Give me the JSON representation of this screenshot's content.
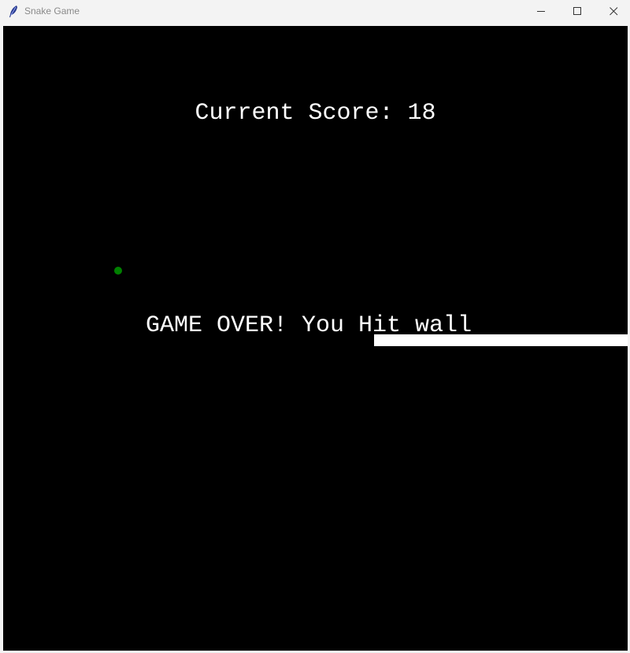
{
  "window": {
    "title": "Snake Game",
    "icon": "feather-icon"
  },
  "controls": {
    "minimize": "minimize-icon",
    "maximize": "maximize-icon",
    "close": "close-icon"
  },
  "game": {
    "score_text": "Current Score: 18",
    "score": 18,
    "game_over_text": "GAME OVER! You Hit wall",
    "background_color": "#000000",
    "snake_color": "#ffffff",
    "food_color": "#008000",
    "text_color": "#ffffff"
  }
}
